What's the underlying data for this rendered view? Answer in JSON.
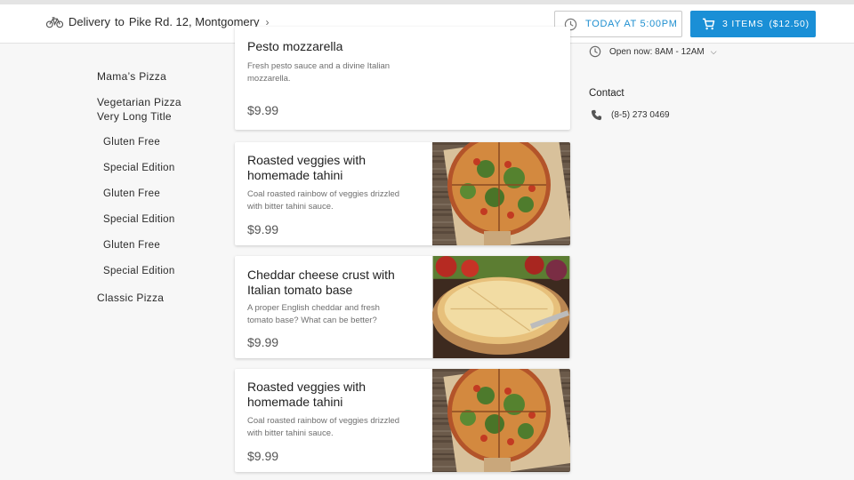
{
  "header": {
    "delivery_label": "Delivery",
    "to_label": "to",
    "address": "Pike Rd. 12, Montgomery",
    "time_button": "TODAY AT 5:00PM",
    "cart_items": "3 ITEMS",
    "cart_total": "($12.50)",
    "accent_color": "#1a8fd6"
  },
  "sidebar": {
    "items": [
      {
        "label": "Mama’s Pizza"
      },
      {
        "label": "Vegetarian Pizza"
      },
      {
        "label": "Very Long Title"
      },
      {
        "label": "Gluten Free"
      },
      {
        "label": "Special Edition"
      },
      {
        "label": "Gluten Free"
      },
      {
        "label": "Special Edition"
      },
      {
        "label": "Gluten Free"
      },
      {
        "label": "Special Edition"
      },
      {
        "label": "Classic Pizza"
      }
    ]
  },
  "menu": {
    "items": [
      {
        "title": "Pesto mozzarella",
        "desc_line1": "Fresh pesto sauce and a divine Italian",
        "desc_line2": "mozzarella.",
        "price": "$9.99"
      },
      {
        "title_line1": "Roasted veggies with",
        "title_line2": "homemade tahini",
        "desc_line1": "Coal roasted rainbow of veggies drizzled",
        "desc_line2": "with bitter tahini sauce.",
        "price": "$9.99",
        "image": "arugula-pizza-photo"
      },
      {
        "title_line1": "Cheddar cheese crust with",
        "title_line2": "Italian tomato base",
        "desc_line1": "A proper English cheddar and fresh",
        "desc_line2": "tomato base? What can be better?",
        "price": "$9.99",
        "image": "cheese-pizza-photo"
      },
      {
        "title_line1": "Roasted veggies with",
        "title_line2": "homemade tahini",
        "desc_line1": "Coal roasted rainbow of veggies drizzled",
        "desc_line2": "with bitter tahini sauce.",
        "price": "$9.99",
        "image": "arugula-pizza-photo"
      }
    ]
  },
  "info": {
    "hours": "Open now: 8AM - 12AM",
    "contact_heading": "Contact",
    "phone": "(8-5) 273 0469"
  }
}
